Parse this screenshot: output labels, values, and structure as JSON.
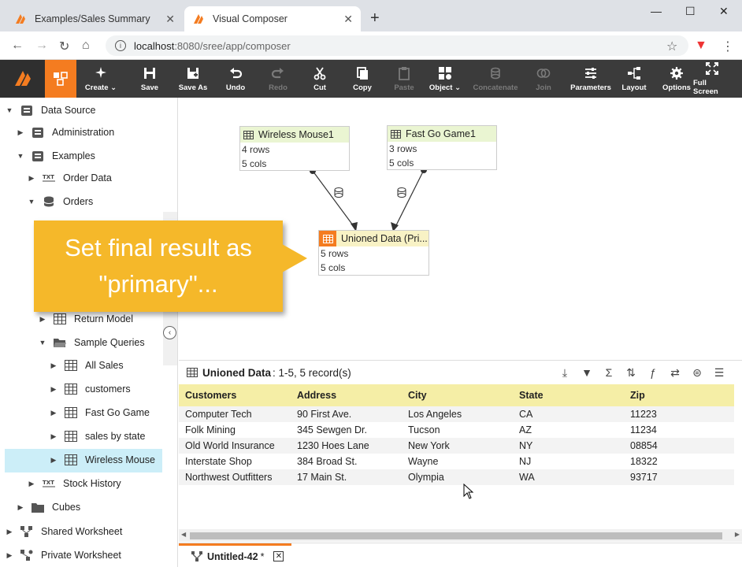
{
  "browser": {
    "tabs": [
      {
        "title": "Examples/Sales Summary",
        "active": false
      },
      {
        "title": "Visual Composer",
        "active": true
      }
    ],
    "url_host": "localhost",
    "url_path": ":8080/sree/app/composer"
  },
  "toolbar": {
    "buttons": [
      {
        "label": "Create",
        "icon": "create-icon",
        "enabled": true,
        "dropdown": true
      },
      {
        "label": "Save",
        "icon": "save-icon",
        "enabled": true
      },
      {
        "label": "Save As",
        "icon": "save-as-icon",
        "enabled": true
      },
      {
        "label": "Undo",
        "icon": "undo-icon",
        "enabled": true
      },
      {
        "label": "Redo",
        "icon": "redo-icon",
        "enabled": false
      },
      {
        "label": "Cut",
        "icon": "cut-icon",
        "enabled": true
      },
      {
        "label": "Copy",
        "icon": "copy-icon",
        "enabled": true
      },
      {
        "label": "Paste",
        "icon": "paste-icon",
        "enabled": false
      },
      {
        "label": "Object",
        "icon": "object-icon",
        "enabled": true,
        "dropdown": true
      },
      {
        "label": "Concatenate",
        "icon": "concatenate-icon",
        "enabled": false
      },
      {
        "label": "Join",
        "icon": "join-icon",
        "enabled": false
      },
      {
        "label": "Parameters",
        "icon": "parameters-icon",
        "enabled": true
      },
      {
        "label": "Layout",
        "icon": "layout-icon",
        "enabled": true
      },
      {
        "label": "Options",
        "icon": "options-icon",
        "enabled": true
      },
      {
        "label": "Full Screen",
        "icon": "fullscreen-icon",
        "enabled": true
      }
    ]
  },
  "tree": {
    "items": [
      {
        "label": "Data Source",
        "type": "datasource"
      },
      {
        "label": "Administration",
        "type": "datasource"
      },
      {
        "label": "Examples",
        "type": "datasource"
      },
      {
        "label": "Order Data",
        "type": "txt"
      },
      {
        "label": "Orders",
        "type": "database"
      },
      {
        "label": "Return Model",
        "type": "table"
      },
      {
        "label": "Sample Queries",
        "type": "folder"
      },
      {
        "label": "All Sales",
        "type": "table"
      },
      {
        "label": "customers",
        "type": "table"
      },
      {
        "label": "Fast Go Game",
        "type": "table"
      },
      {
        "label": "sales by state",
        "type": "table"
      },
      {
        "label": "Wireless Mouse",
        "type": "table"
      },
      {
        "label": "Stock History",
        "type": "txt"
      },
      {
        "label": "Cubes",
        "type": "folder"
      },
      {
        "label": "Shared Worksheet",
        "type": "worksheet"
      },
      {
        "label": "Private Worksheet",
        "type": "worksheet"
      }
    ]
  },
  "canvas": {
    "nodes": [
      {
        "title": "Wireless Mouse1",
        "rows": "4 rows",
        "cols": "5 cols"
      },
      {
        "title": "Fast Go Game1",
        "rows": "3 rows",
        "cols": "5 cols"
      },
      {
        "title": "Unioned Data (Pri...",
        "rows": "5 rows",
        "cols": "5 cols"
      }
    ]
  },
  "callout": {
    "line1": "Set final result as",
    "line2": "\"primary\"..."
  },
  "panel": {
    "title": "Unioned Data",
    "summary": ": 1-5, 5 record(s)",
    "columns": [
      "Customers",
      "Address",
      "City",
      "State",
      "Zip"
    ],
    "rows": [
      [
        "Computer Tech",
        "90 First Ave.",
        "Los Angeles",
        "CA",
        "11223"
      ],
      [
        "Folk Mining",
        "345 Sewgen Dr.",
        "Tucson",
        "AZ",
        "11234"
      ],
      [
        "Old World Insurance",
        "1230 Hoes Lane",
        "New York",
        "NY",
        "08854"
      ],
      [
        "Interstate Shop",
        "384 Broad St.",
        "Wayne",
        "NJ",
        "18322"
      ],
      [
        "Northwest Outfitters",
        "17 Main St.",
        "Olympia",
        "WA",
        "93717"
      ]
    ]
  },
  "bottom_tab": {
    "label": "Untitled-42",
    "modified": "*"
  },
  "colors": {
    "accent": "#f47c20",
    "callout": "#f5b82a",
    "table_header": "#f5eea6",
    "node_header": "#eaf5d2"
  }
}
